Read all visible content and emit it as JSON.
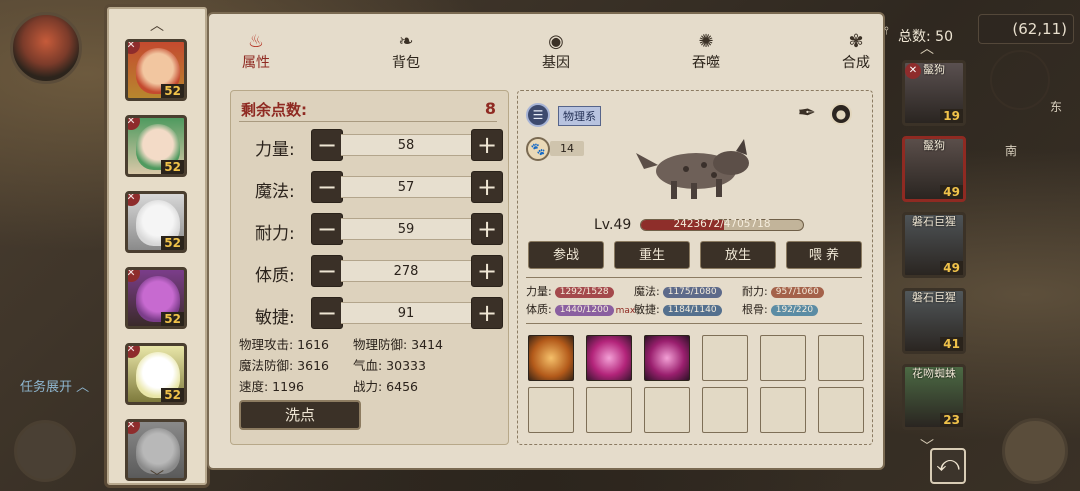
{
  "colors": {
    "accent": "#8f2a22",
    "panel": "#e5dccb",
    "dark_button": "#3b3127",
    "level": "#f0c24a"
  },
  "hud": {
    "coords": "(62,11)",
    "task_expand": "任务展开",
    "compass_e": "东",
    "compass_s": "南",
    "total_label": "总数: 50"
  },
  "roster": [
    {
      "level": "52",
      "colors": [
        "#c44a2f",
        "#f2c6a0",
        "#b8872e"
      ]
    },
    {
      "level": "52",
      "colors": [
        "#4f9a5f",
        "#f3dbc7",
        "#d9c8a8"
      ]
    },
    {
      "level": "52",
      "colors": [
        "#d7d7d7",
        "#f5f5f5",
        "#8a8a8a"
      ]
    },
    {
      "level": "52",
      "colors": [
        "#7b3d8a",
        "#c76ad0",
        "#3a2a2a"
      ]
    },
    {
      "level": "52",
      "colors": [
        "#e9e6a8",
        "#ffffff",
        "#7e7a3c"
      ]
    },
    {
      "level": "",
      "colors": [
        "#8a8a8a",
        "#b8b8b8",
        "#5a5a5a"
      ]
    }
  ],
  "tabs": [
    {
      "label": "属性",
      "icon": "flame-icon",
      "glyph": "♨"
    },
    {
      "label": "背包",
      "icon": "bag-icon",
      "glyph": "❧"
    },
    {
      "label": "基因",
      "icon": "eye-icon",
      "glyph": "◉"
    },
    {
      "label": "吞噬",
      "icon": "swirl-icon",
      "glyph": "✺"
    },
    {
      "label": "合成",
      "icon": "shell-icon",
      "glyph": "✾"
    }
  ],
  "points": {
    "label": "剩余点数:",
    "value": "8"
  },
  "attrs": [
    {
      "label": "力量:",
      "value": "58"
    },
    {
      "label": "魔法:",
      "value": "57"
    },
    {
      "label": "耐力:",
      "value": "59"
    },
    {
      "label": "体质:",
      "value": "278"
    },
    {
      "label": "敏捷:",
      "value": "91"
    }
  ],
  "derived": [
    {
      "text": "物理攻击: 1616"
    },
    {
      "text": "物理防御: 3414"
    },
    {
      "text": "魔法防御: 3616"
    },
    {
      "text": "气血: 30333"
    },
    {
      "text": "速度: 1196"
    },
    {
      "text": "战力: 6456"
    }
  ],
  "wash_button": "洗点",
  "pet": {
    "type_label": "物理系",
    "paw_count": "14",
    "level": "Lv.49",
    "hp": "2423672/4705718",
    "hp_ratio": 0.515,
    "actions": [
      "参战",
      "重生",
      "放生",
      "喂 养"
    ],
    "stats": [
      {
        "label": "力量:",
        "value": "1292/1528",
        "ratio": 0.85,
        "color": "#a4494c"
      },
      {
        "label": "魔法:",
        "value": "1175/1080",
        "ratio": 1.0,
        "color": "#5d6a8a"
      },
      {
        "label": "耐力:",
        "value": "957/1060",
        "ratio": 0.9,
        "color": "#a4624a"
      },
      {
        "label": "体质:",
        "value": "1440/1200",
        "ratio": 1.0,
        "color": "#8a5fa0",
        "suffix": "max"
      },
      {
        "label": "敏捷:",
        "value": "1184/1140",
        "ratio": 1.0,
        "color": "#54708e"
      },
      {
        "label": "根骨:",
        "value": "192/220",
        "ratio": 0.87,
        "color": "#5b8ca4"
      }
    ],
    "skills": [
      "burst-skill-icon",
      "vortex-skill-icon",
      "arrow-skill-icon"
    ]
  },
  "enemies": [
    {
      "name": "鬣狗",
      "level": "19"
    },
    {
      "name": "鬣狗",
      "level": "49"
    },
    {
      "name": "磐石巨猩",
      "level": "49"
    },
    {
      "name": "磐石巨猩",
      "level": "41"
    },
    {
      "name": "花吻蜘蛛",
      "level": "23"
    }
  ]
}
